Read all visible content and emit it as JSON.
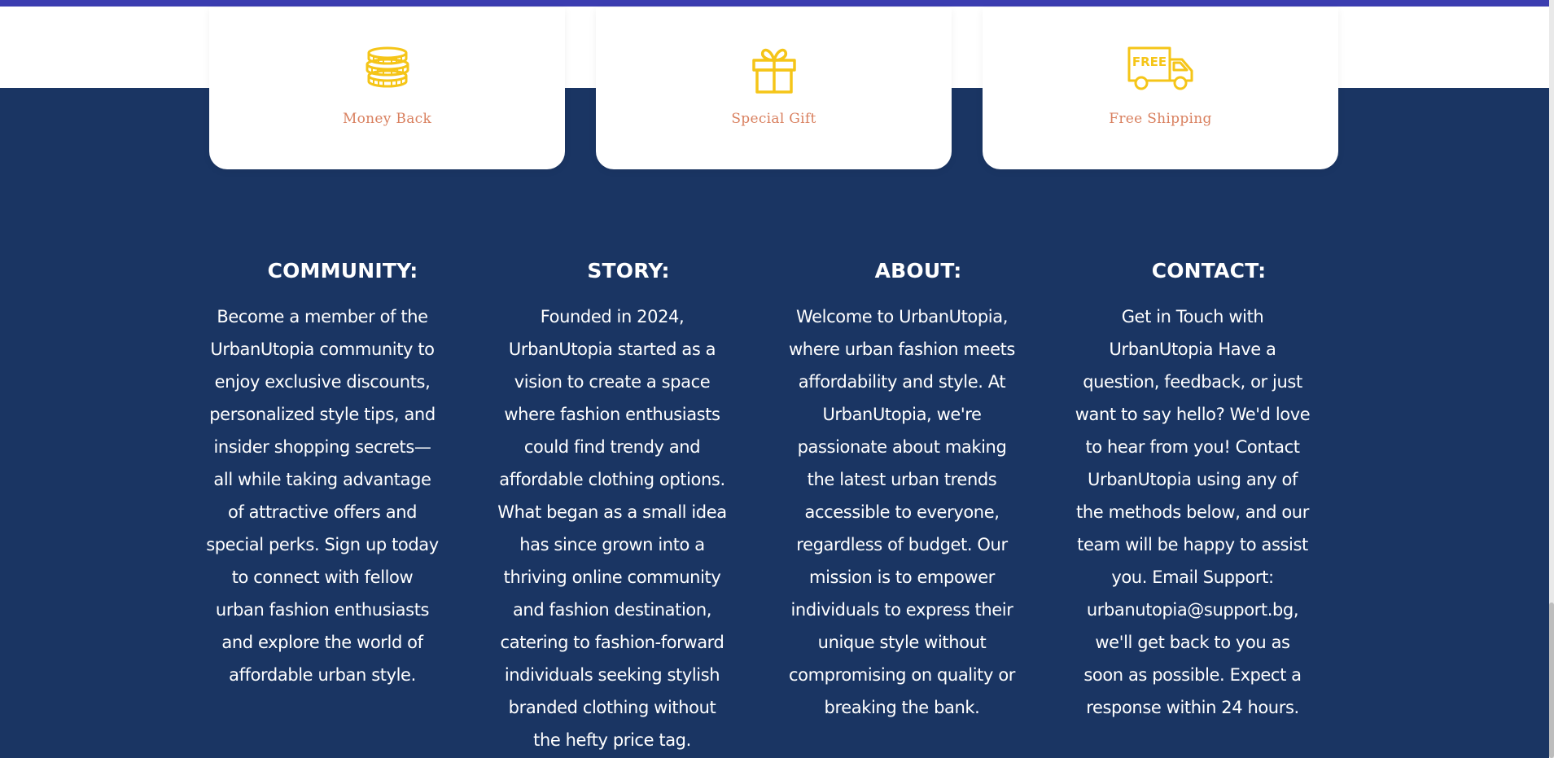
{
  "features": [
    {
      "label": "Money Back",
      "icon": "coins-icon"
    },
    {
      "label": "Special Gift",
      "icon": "gift-icon"
    },
    {
      "label": "Free Shipping",
      "icon": "free-delivery-truck-icon"
    }
  ],
  "truck_badge_text": "FREE",
  "footer": {
    "community": {
      "title": "COMMUNITY:",
      "text": "Become a member of the UrbanUtopia community to enjoy exclusive discounts, personalized style tips, and insider shopping secrets—all while taking advantage of attractive offers and special perks. Sign up today to connect with fellow urban fashion enthusiasts and explore the world of affordable urban style."
    },
    "story": {
      "title": "STORY:",
      "text": "Founded in 2024, UrbanUtopia started as a vision to create a space where fashion enthusiasts could find trendy and affordable clothing options. What began as a small idea has since grown into a thriving online community and fashion destination, catering to fashion-forward individuals seeking stylish branded clothing without the hefty price tag."
    },
    "about": {
      "title": "ABOUT:",
      "text": "Welcome to UrbanUtopia, where urban fashion meets affordability and style. At UrbanUtopia, we're passionate about making the latest urban trends accessible to everyone, regardless of budget. Our mission is to empower individuals to express their unique style without compromising on quality or breaking the bank."
    },
    "contact": {
      "title": "CONTACT:",
      "text": "Get in Touch with UrbanUtopia Have a question, feedback, or just want to say hello? We'd love to hear from you! Contact UrbanUtopia using any of the methods below, and our team will be happy to assist you. Email Support: urbanutopia@support.bg, we'll get back to you as soon as possible. Expect a response within 24 hours."
    }
  },
  "colors": {
    "background": "#1a3563",
    "card_label": "#d9805f",
    "icon": "#f5c518",
    "top_bar": "#3b3db0"
  }
}
